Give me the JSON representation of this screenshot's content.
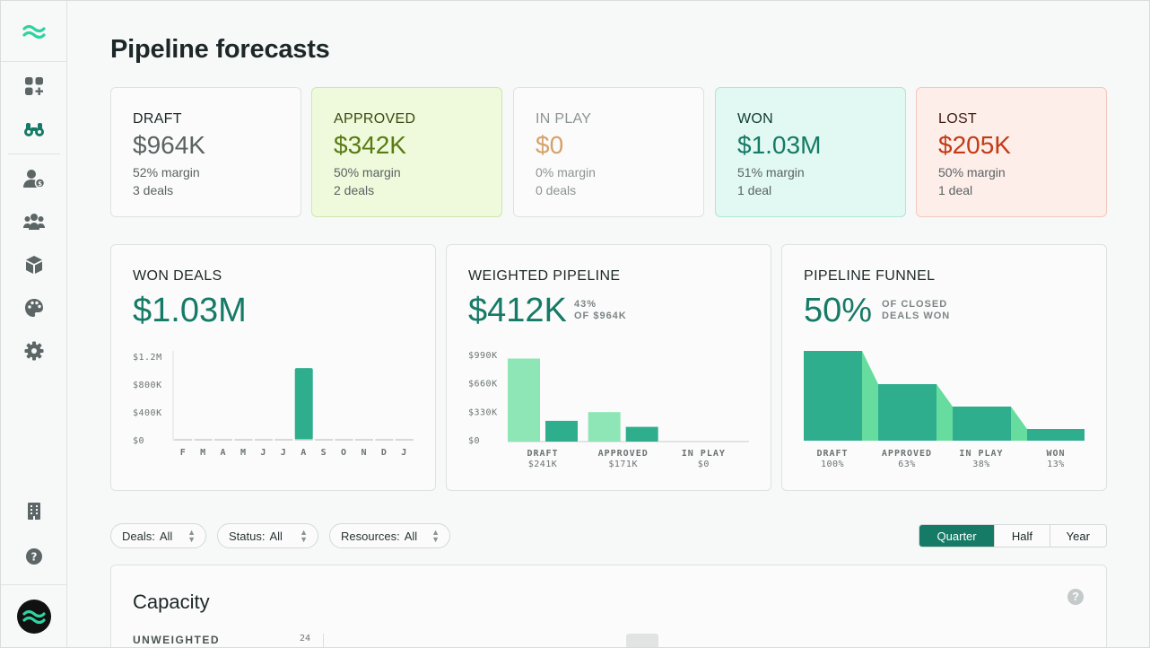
{
  "page": {
    "title": "Pipeline forecasts"
  },
  "sidebar": {
    "icons": [
      "apps-add-icon",
      "binoculars-icon",
      "user-dollar-icon",
      "team-icon",
      "box-icon",
      "palette-icon",
      "gear-icon",
      "building-icon",
      "help-icon"
    ],
    "accent": "#2fbf8f"
  },
  "stats": [
    {
      "label": "DRAFT",
      "value": "$964K",
      "margin": "52% margin",
      "deals": "3 deals"
    },
    {
      "label": "APPROVED",
      "value": "$342K",
      "margin": "50% margin",
      "deals": "2 deals"
    },
    {
      "label": "IN PLAY",
      "value": "$0",
      "margin": "0% margin",
      "deals": "0 deals"
    },
    {
      "label": "WON",
      "value": "$1.03M",
      "margin": "51% margin",
      "deals": "1 deal"
    },
    {
      "label": "LOST",
      "value": "$205K",
      "margin": "50% margin",
      "deals": "1 deal"
    }
  ],
  "won_card": {
    "title": "WON DEALS",
    "value": "$1.03M"
  },
  "weighted_card": {
    "title": "WEIGHTED PIPELINE",
    "value": "$412K",
    "note_line1": "43%",
    "note_line2": "OF $964K"
  },
  "funnel_card": {
    "title": "PIPELINE FUNNEL",
    "value": "50%",
    "note_line1": "OF CLOSED",
    "note_line2": "DEALS WON"
  },
  "chart_data": [
    {
      "type": "bar",
      "title": "WON DEALS",
      "categories": [
        "F",
        "M",
        "A",
        "M",
        "J",
        "J",
        "A",
        "S",
        "O",
        "N",
        "D",
        "J"
      ],
      "values": [
        0,
        0,
        0,
        0,
        0,
        0,
        1030000,
        0,
        0,
        0,
        0,
        0
      ],
      "yticks": [
        "$0",
        "$400K",
        "$800K",
        "$1.2M"
      ],
      "ylim": [
        0,
        1200000
      ],
      "color": "#2fae8e"
    },
    {
      "type": "bar",
      "title": "WEIGHTED PIPELINE",
      "categories": [
        "DRAFT",
        "APPROVED",
        "IN PLAY"
      ],
      "category_values": [
        "$241K",
        "$171K",
        "$0"
      ],
      "series": [
        {
          "values": [
            964000,
            342000,
            0
          ],
          "color": "#8ee6b6"
        },
        {
          "values": [
            241000,
            171000,
            0
          ],
          "color": "#2fae8e"
        }
      ],
      "yticks": [
        "$0",
        "$330K",
        "$660K",
        "$990K"
      ],
      "ylim": [
        0,
        990000
      ]
    },
    {
      "type": "area",
      "title": "PIPELINE FUNNEL",
      "categories": [
        "DRAFT",
        "APPROVED",
        "IN PLAY",
        "WON"
      ],
      "percent_labels": [
        "100%",
        "63%",
        "38%",
        "13%"
      ],
      "values": [
        100,
        63,
        38,
        13
      ],
      "color": "#2fae8e",
      "connector_color": "#66dd9e"
    }
  ],
  "filters": [
    {
      "key": "Deals:",
      "value": "All"
    },
    {
      "key": "Status:",
      "value": "All"
    },
    {
      "key": "Resources:",
      "value": "All"
    }
  ],
  "period": {
    "options": [
      "Quarter",
      "Half",
      "Year"
    ],
    "selected": "Quarter"
  },
  "capacity": {
    "title": "Capacity",
    "row_label": "UNWEIGHTED",
    "tick": "24"
  }
}
